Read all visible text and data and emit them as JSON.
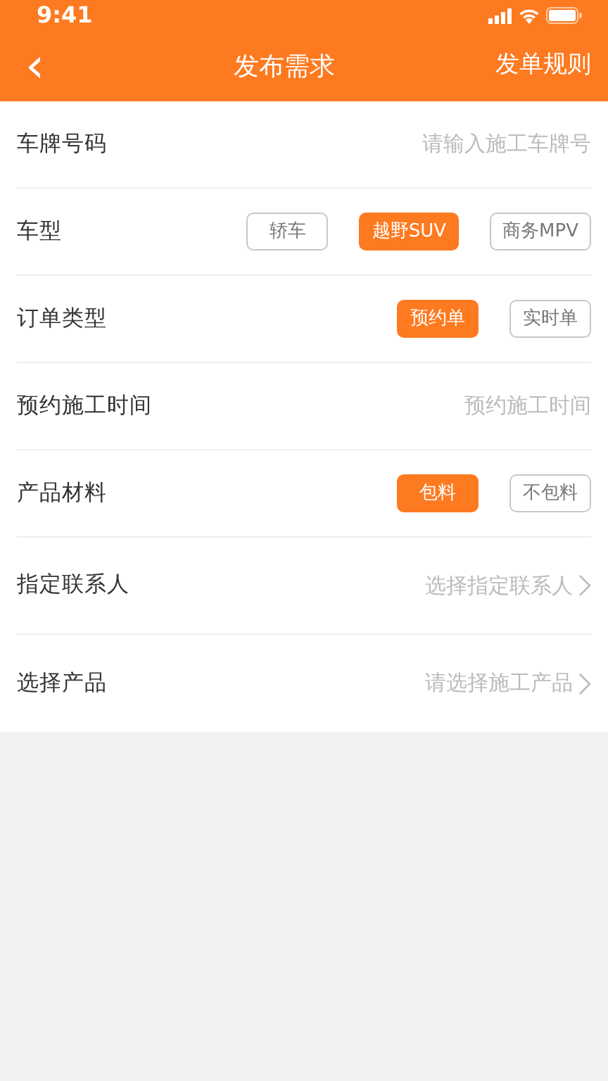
{
  "status_bar": {
    "time": "9:41"
  },
  "nav": {
    "back": "‹",
    "title": "发布需求",
    "action": "发单规则"
  },
  "form": [
    {
      "kind": "input",
      "label": "车牌号码",
      "placeholder": "请输入施工车牌号"
    },
    {
      "kind": "options",
      "label": "车型",
      "options": [
        {
          "label": "轿车",
          "selected": false
        },
        {
          "label": "越野SUV",
          "selected": true
        },
        {
          "label": "商务MPV",
          "selected": false
        }
      ]
    },
    {
      "kind": "options",
      "label": "订单类型",
      "options": [
        {
          "label": "预约单",
          "selected": true
        },
        {
          "label": "实时单",
          "selected": false
        }
      ]
    },
    {
      "kind": "input",
      "label": "预约施工时间",
      "placeholder": "预约施工时间"
    },
    {
      "kind": "options",
      "label": "产品材料",
      "options": [
        {
          "label": "包料",
          "selected": true
        },
        {
          "label": "不包料",
          "selected": false
        }
      ]
    },
    {
      "kind": "select",
      "label": "指定联系人",
      "placeholder": "选择指定联系人"
    },
    {
      "kind": "select",
      "label": "选择产品",
      "placeholder": "请选择施工产品"
    }
  ]
}
